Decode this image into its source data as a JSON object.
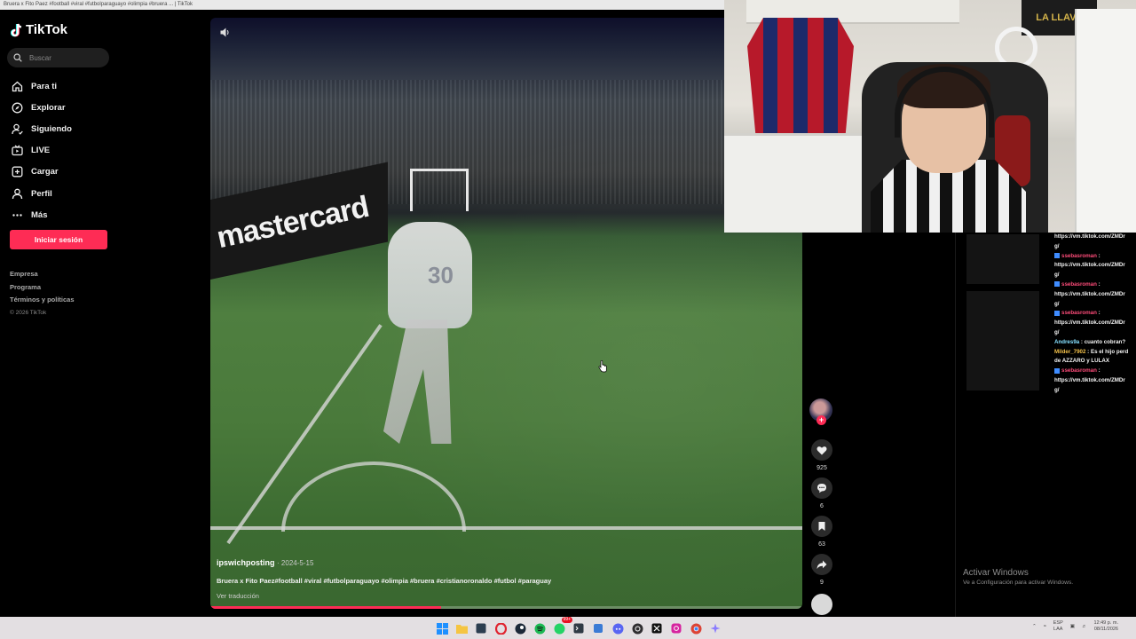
{
  "window": {
    "title": "Bruera x Fito Paez #football #viral #futbolparaguayo #olimpia #bruera ... | TikTok"
  },
  "sidebar": {
    "logo": "TikTok",
    "search_placeholder": "Buscar",
    "nav": [
      {
        "label": "Para ti",
        "icon": "home-icon"
      },
      {
        "label": "Explorar",
        "icon": "compass-icon"
      },
      {
        "label": "Siguiendo",
        "icon": "user-follow-icon"
      },
      {
        "label": "LIVE",
        "icon": "live-tv-icon"
      },
      {
        "label": "Cargar",
        "icon": "upload-plus-icon"
      },
      {
        "label": "Perfil",
        "icon": "profile-icon"
      },
      {
        "label": "Más",
        "icon": "more-dots-icon"
      }
    ],
    "login_button": "Iniciar sesión",
    "footer": {
      "links": [
        "Empresa",
        "Programa",
        "Términos y políticas"
      ],
      "copyright": "© 2026 TikTok"
    }
  },
  "video": {
    "board_text": "mastercard",
    "shirt_number": "30",
    "author": "ipswichposting",
    "date": "· 2024-5-15",
    "description": "Bruera x Fito Paez#football #viral #futbolparaguayo #olimpia #bruera #cristianoronaldo #futbol #paraguay",
    "translate": "Ver traducción",
    "progress": 0.39
  },
  "actions": {
    "likes": "925",
    "comments": "6",
    "saves": "63",
    "shares": "9"
  },
  "webcam": {
    "banner": "LA LLAVE"
  },
  "chat": [
    {
      "user": "",
      "text": "https://vm.tiktok.com/ZMDr",
      "cont": "g/"
    },
    {
      "user": "ssebasroman",
      "text": "https://vm.tiktok.com/ZMDr",
      "cont": "g/"
    },
    {
      "user": "ssebasroman",
      "text": "https://vm.tiktok.com/ZMDr",
      "cont": "g/"
    },
    {
      "user": "ssebasroman",
      "text": "https://vm.tiktok.com/ZMDr",
      "cont": "g/"
    },
    {
      "user": "Andres9a",
      "text": "cuanto cobran?"
    },
    {
      "user": "Milder_7902",
      "text": "Es el hijo perd",
      "cont": "de AZZARO y LULAX"
    },
    {
      "user": "ssebasroman",
      "text": "https://vm.tiktok.com/ZMDr",
      "cont": "g/"
    }
  ],
  "watermark": {
    "title": "Activar Windows",
    "subtitle": "Ve a Configuración para activar Windows."
  },
  "taskbar": {
    "lang_top": "ESP",
    "lang_bottom": "LAA",
    "time": "12:49 p. m.",
    "date": "08/11/2026",
    "spotify_badge": "99+"
  }
}
